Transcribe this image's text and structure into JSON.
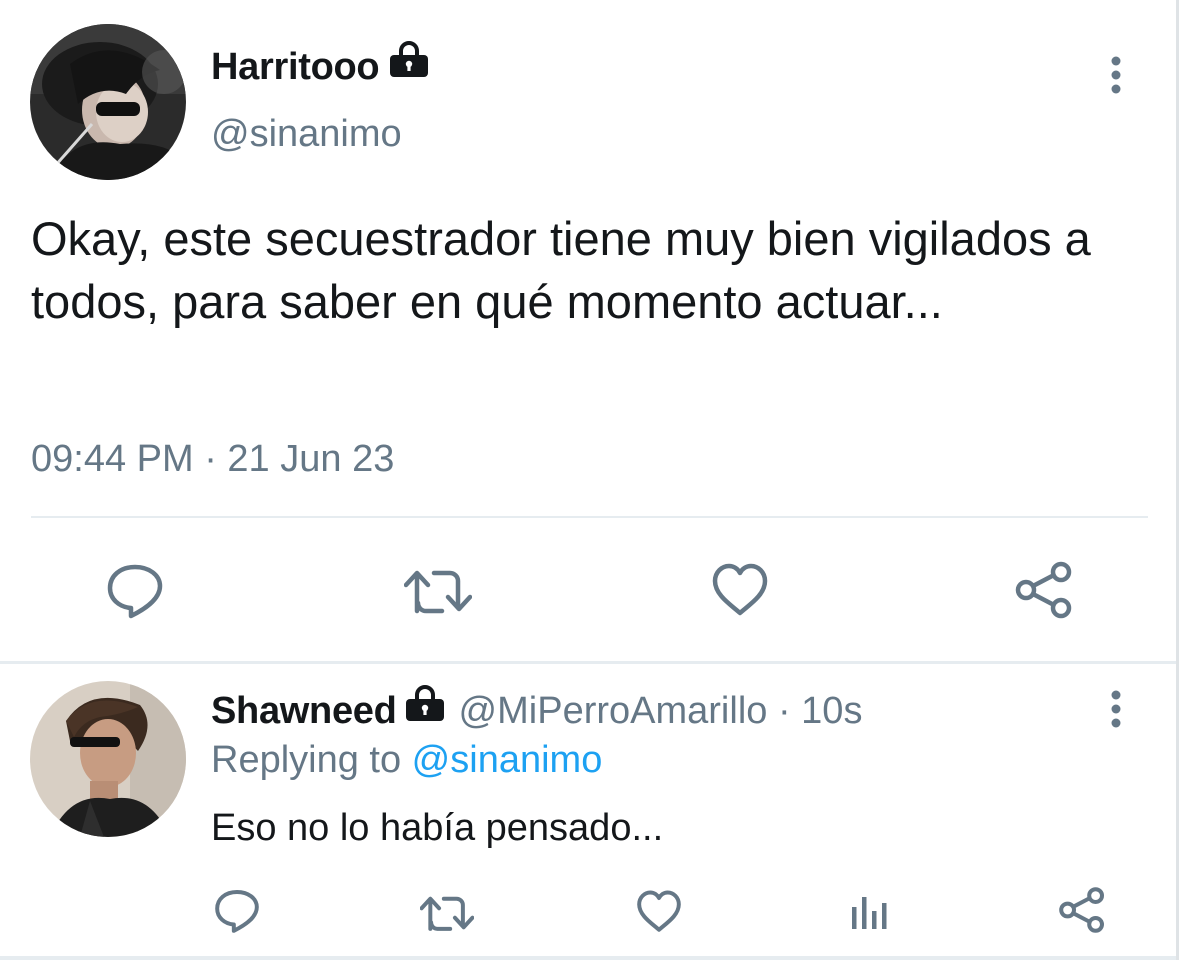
{
  "tweet": {
    "display_name": "Harritooo",
    "protected_icon": "lock-icon",
    "handle": "@sinanimo",
    "text": "Okay, este secuestrador tiene muy bien vigilados a todos, para saber en qué momento actuar...",
    "timestamp": "09:44 PM · 21 Jun 23",
    "actions": [
      "reply-icon",
      "retweet-icon",
      "like-icon",
      "share-icon"
    ]
  },
  "reply": {
    "display_name": "Shawneed",
    "protected_icon": "lock-icon",
    "handle": "@MiPerroAmarillo",
    "separator": " · ",
    "time_ago": "10s",
    "replying_prefix": "Replying to ",
    "replying_to": "@sinanimo",
    "text": "Eso no lo había pensado...",
    "actions": [
      "reply-icon",
      "retweet-icon",
      "like-icon",
      "analytics-icon",
      "share-icon"
    ]
  },
  "colors": {
    "text_primary": "#14171a",
    "text_secondary": "#657786",
    "link": "#1da1f2",
    "divider": "#e6ecf0",
    "icon": "#657786"
  }
}
